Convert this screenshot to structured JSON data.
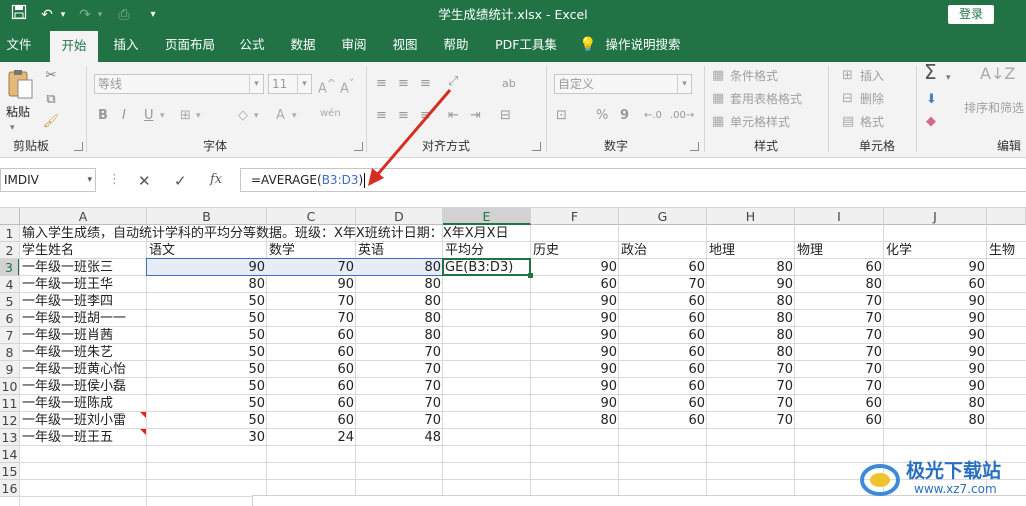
{
  "titlebar": {
    "title": "学生成绩统计.xlsx  -  Excel",
    "login": "登录",
    "icons": [
      "save-icon",
      "undo-icon",
      "redo-icon",
      "print-preview-icon",
      "customize-quick-access-icon"
    ]
  },
  "tabs": [
    "文件",
    "开始",
    "插入",
    "页面布局",
    "公式",
    "数据",
    "审阅",
    "视图",
    "帮助",
    "PDF工具集",
    "操作说明搜索"
  ],
  "ribbon": {
    "clipboard": {
      "paste_label": "粘贴",
      "group": "剪贴板"
    },
    "font": {
      "font_name": "等线",
      "font_size": "11",
      "group": "字体",
      "bold": "B",
      "italic": "I",
      "underline": "U",
      "font_color": "A"
    },
    "alignment": {
      "group": "对齐方式"
    },
    "number": {
      "format": "自定义",
      "group": "数字",
      "percent": "%",
      "comma": "9"
    },
    "styles": {
      "conditional": "条件格式",
      "table": "套用表格格式",
      "cell_style": "单元格样式",
      "group": "样式"
    },
    "cells": {
      "insert": "插入",
      "delete": "删除",
      "format": "格式",
      "group": "单元格"
    },
    "editing": {
      "sort": "排序和筛选",
      "group": "编辑"
    }
  },
  "formula_bar": {
    "name_box": "IMDIV",
    "cancel": "✕",
    "enter": "✓",
    "fx": "fx",
    "formula_prefix": "=AVERAGE(",
    "formula_ref": "B3:D3",
    "formula_suffix": ")"
  },
  "grid": {
    "columns": [
      "A",
      "B",
      "C",
      "D",
      "E",
      "F",
      "G",
      "H",
      "I",
      "J"
    ],
    "rows": [
      "1",
      "2",
      "3",
      "4",
      "5",
      "6",
      "7",
      "8",
      "9",
      "10",
      "11",
      "12",
      "13",
      "14",
      "15",
      "16"
    ],
    "title_text": "输入学生成绩，自动统计学科的平均分等数据。班级：X年X班统计日期：X年X月X日",
    "headers": [
      "学生姓名",
      "语文",
      "数学",
      "英语",
      "平均分",
      "历史",
      "政治",
      "地理",
      "物理",
      "化学",
      "生物"
    ],
    "editing_text": "GE(B3:D3)",
    "students": [
      {
        "name": "一年级一班张三",
        "scores": [
          "90",
          "70",
          "80",
          "",
          "90",
          "60",
          "80",
          "60",
          "90"
        ]
      },
      {
        "name": "一年级一班王华",
        "scores": [
          "80",
          "90",
          "80",
          "",
          "60",
          "70",
          "90",
          "80",
          "60"
        ]
      },
      {
        "name": "一年级一班李四",
        "scores": [
          "50",
          "70",
          "80",
          "",
          "90",
          "60",
          "80",
          "70",
          "90"
        ]
      },
      {
        "name": "一年级一班胡一一",
        "scores": [
          "50",
          "70",
          "80",
          "",
          "90",
          "60",
          "80",
          "70",
          "90"
        ]
      },
      {
        "name": "一年级一班肖茜",
        "scores": [
          "50",
          "60",
          "80",
          "",
          "90",
          "60",
          "80",
          "70",
          "90"
        ]
      },
      {
        "name": "一年级一班朱艺",
        "scores": [
          "50",
          "60",
          "70",
          "",
          "90",
          "60",
          "80",
          "70",
          "90"
        ]
      },
      {
        "name": "一年级一班黄心怡",
        "scores": [
          "50",
          "60",
          "70",
          "",
          "90",
          "60",
          "70",
          "70",
          "90"
        ]
      },
      {
        "name": "一年级一班侯小磊",
        "scores": [
          "50",
          "60",
          "70",
          "",
          "90",
          "60",
          "70",
          "70",
          "90"
        ]
      },
      {
        "name": "一年级一班陈成",
        "scores": [
          "50",
          "60",
          "70",
          "",
          "90",
          "60",
          "70",
          "60",
          "80"
        ]
      },
      {
        "name": "一年级一班刘小雷",
        "scores": [
          "50",
          "60",
          "70",
          "",
          "80",
          "60",
          "70",
          "60",
          "80"
        ]
      },
      {
        "name": "一年级一班王五",
        "scores": [
          "30",
          "24",
          "48",
          "",
          "",
          "",
          "",
          "",
          ""
        ]
      }
    ]
  },
  "watermark": {
    "brand": "极光下载站",
    "url": "www.xz7.com"
  },
  "colors": {
    "accent": "#217346",
    "arrow": "#d62d20",
    "selection": "#217346",
    "ref_blue": "#3a6fc4"
  }
}
